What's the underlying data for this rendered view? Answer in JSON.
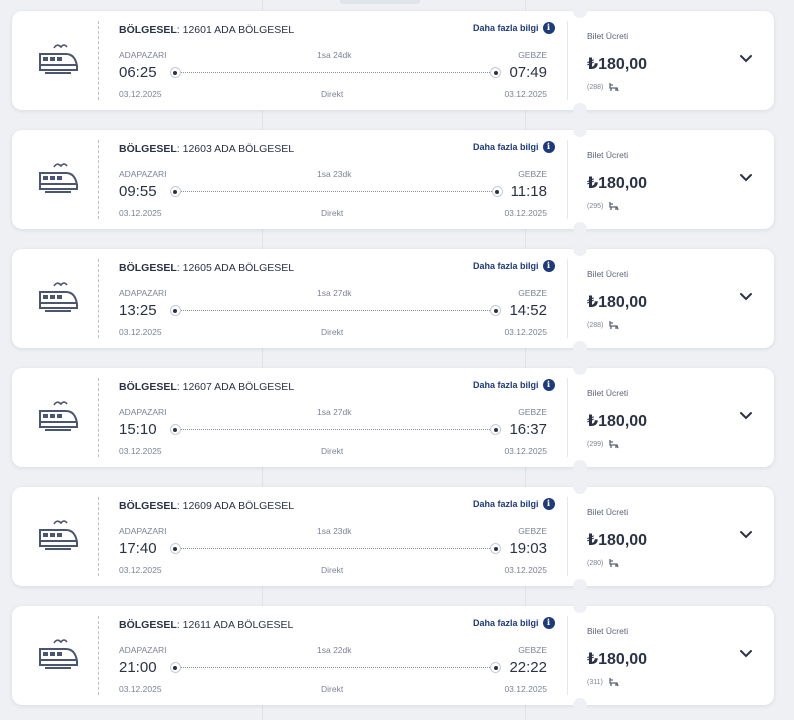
{
  "labels": {
    "route_prefix": "BÖLGESEL",
    "more_info": "Daha fazla bilgi",
    "info_glyph": "i",
    "price_label": "Bilet Ücreti",
    "direct": "Direkt"
  },
  "colors": {
    "accent": "#1d3a7a",
    "text": "#2b3245",
    "muted": "#7c8396",
    "background": "#eef0f3"
  },
  "icons": {
    "train": "train-icon",
    "info": "info-icon",
    "seat": "seat-icon",
    "expand": "chevron-down-icon"
  },
  "trains": [
    {
      "route": ": 12601 ADA BÖLGESEL",
      "from": "ADAPAZARI",
      "to": "GEBZE",
      "duration": "1sa 24dk",
      "dep_time": "06:25",
      "arr_time": "07:49",
      "dep_date": "03.12.2025",
      "arr_date": "03.12.2025",
      "price": "₺180,00",
      "seats": "(288)"
    },
    {
      "route": ": 12603 ADA BÖLGESEL",
      "from": "ADAPAZARI",
      "to": "GEBZE",
      "duration": "1sa 23dk",
      "dep_time": "09:55",
      "arr_time": "11:18",
      "dep_date": "03.12.2025",
      "arr_date": "03.12.2025",
      "price": "₺180,00",
      "seats": "(295)"
    },
    {
      "route": ": 12605 ADA BÖLGESEL",
      "from": "ADAPAZARI",
      "to": "GEBZE",
      "duration": "1sa 27dk",
      "dep_time": "13:25",
      "arr_time": "14:52",
      "dep_date": "03.12.2025",
      "arr_date": "03.12.2025",
      "price": "₺180,00",
      "seats": "(288)"
    },
    {
      "route": ": 12607 ADA BÖLGESEL",
      "from": "ADAPAZARI",
      "to": "GEBZE",
      "duration": "1sa 27dk",
      "dep_time": "15:10",
      "arr_time": "16:37",
      "dep_date": "03.12.2025",
      "arr_date": "03.12.2025",
      "price": "₺180,00",
      "seats": "(299)"
    },
    {
      "route": ": 12609 ADA BÖLGESEL",
      "from": "ADAPAZARI",
      "to": "GEBZE",
      "duration": "1sa 23dk",
      "dep_time": "17:40",
      "arr_time": "19:03",
      "dep_date": "03.12.2025",
      "arr_date": "03.12.2025",
      "price": "₺180,00",
      "seats": "(280)"
    },
    {
      "route": ": 12611 ADA BÖLGESEL",
      "from": "ADAPAZARI",
      "to": "GEBZE",
      "duration": "1sa 22dk",
      "dep_time": "21:00",
      "arr_time": "22:22",
      "dep_date": "03.12.2025",
      "arr_date": "03.12.2025",
      "price": "₺180,00",
      "seats": "(311)"
    }
  ]
}
